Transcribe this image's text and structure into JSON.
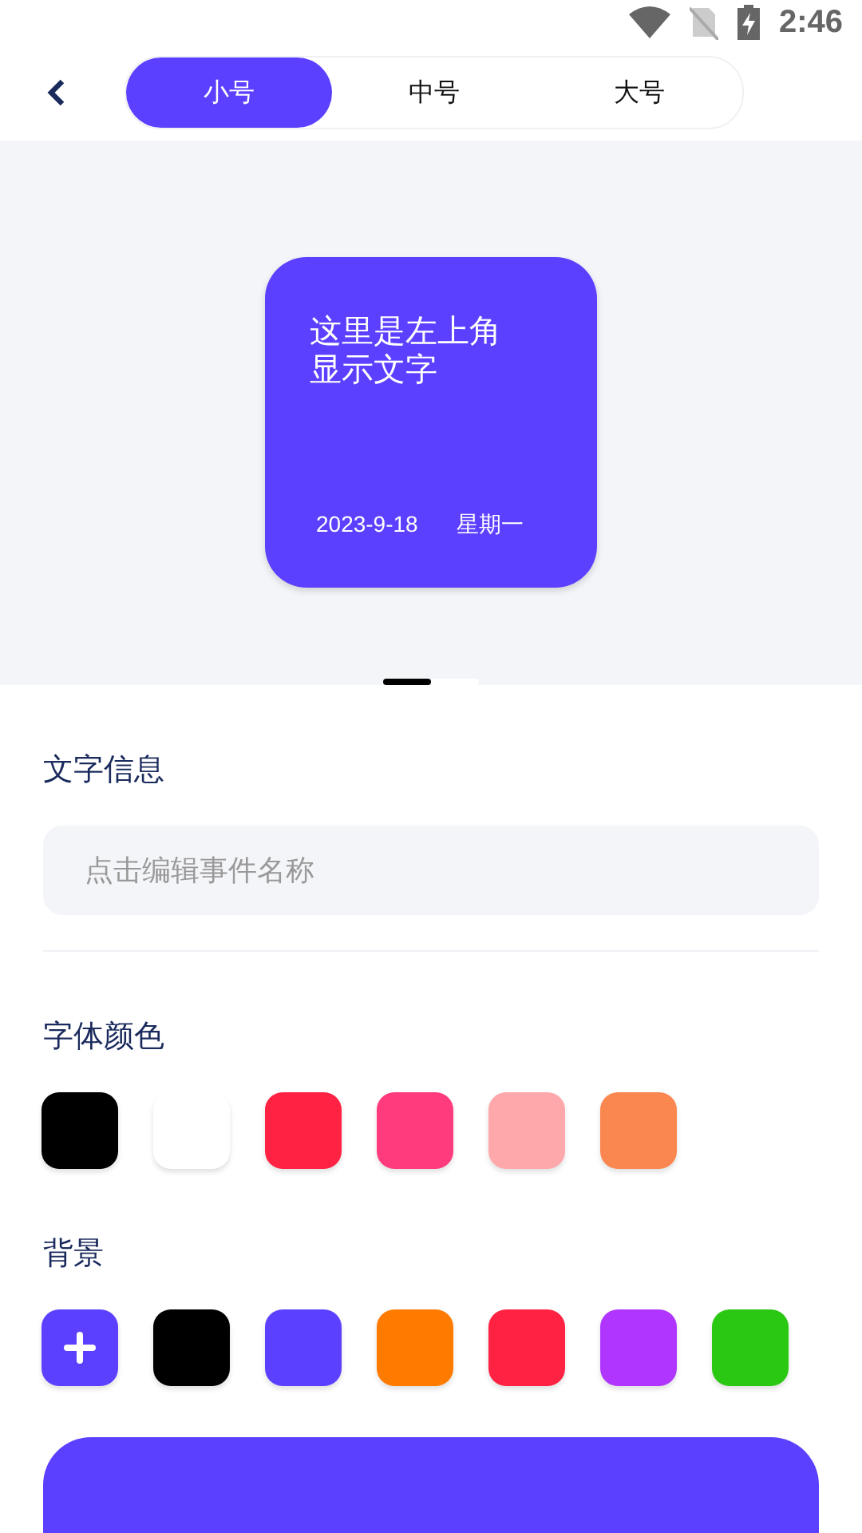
{
  "status_bar": {
    "time": "2:46"
  },
  "tabs": [
    {
      "label": "小号",
      "selected": true
    },
    {
      "label": "中号",
      "selected": false
    },
    {
      "label": "大号",
      "selected": false
    }
  ],
  "preview": {
    "title": "这里是左上角显示文字",
    "date": "2023-9-18",
    "weekday": "星期一",
    "color": "#5b41ff"
  },
  "pager": [
    {
      "selected": true
    },
    {
      "selected": false
    }
  ],
  "text_section": {
    "title": "文字信息",
    "placeholder": "点击编辑事件名称"
  },
  "font_color_section": {
    "title": "字体颜色",
    "swatches": [
      {
        "color": "#000000"
      },
      {
        "color": "#ffffff"
      },
      {
        "color": "#ff2242"
      },
      {
        "color": "#ff3a7d"
      },
      {
        "color": "#ffa8ab"
      },
      {
        "color": "#fa874f"
      }
    ]
  },
  "background_section": {
    "title": "背景",
    "swatches": [
      {
        "kind": "add",
        "color": "#5b41ff"
      },
      {
        "kind": "color",
        "color": "#000000"
      },
      {
        "kind": "color",
        "color": "#5b41ff"
      },
      {
        "kind": "color",
        "color": "#ff7b00"
      },
      {
        "kind": "color",
        "color": "#ff2242"
      },
      {
        "kind": "color",
        "color": "#b036ff"
      },
      {
        "kind": "color",
        "color": "#2ac812"
      }
    ]
  }
}
